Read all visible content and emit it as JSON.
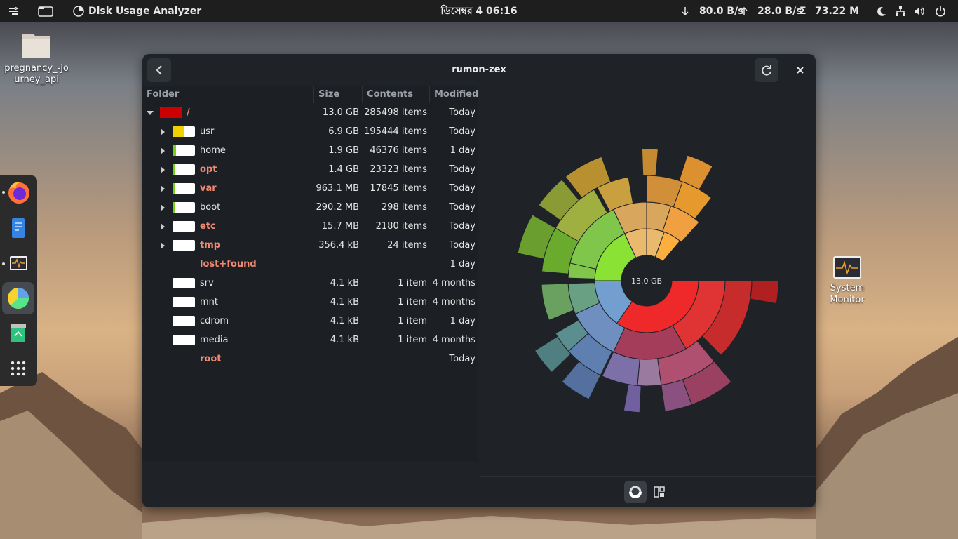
{
  "topbar": {
    "app_name": "Disk Usage Analyzer",
    "clock": "ডিসেম্বর 4  06:16",
    "net_down": "80.0 B/s",
    "net_up": "28.0 B/s",
    "mem_symbol": "Σ",
    "memory": "73.22 M"
  },
  "desktop": {
    "folder_label": "pregnancy_-journey_api",
    "sysmon_label": "System Monitor"
  },
  "window": {
    "title": "rumon-zex",
    "columns": {
      "folder": "Folder",
      "size": "Size",
      "contents": "Contents",
      "modified": "Modified"
    },
    "rows": [
      {
        "name": "/",
        "size": "13.0 GB",
        "contents": "285498 items",
        "modified": "Today",
        "emph": true,
        "fill": 1.0,
        "color": "#cc0000"
      },
      {
        "name": "usr",
        "size": "6.9 GB",
        "contents": "195444 items",
        "modified": "Today",
        "emph": false,
        "fill": 0.53,
        "color": "#f0d000"
      },
      {
        "name": "home",
        "size": "1.9 GB",
        "contents": "46376 items",
        "modified": "1 day",
        "emph": false,
        "fill": 0.15,
        "color": "#73d216"
      },
      {
        "name": "opt",
        "size": "1.4 GB",
        "contents": "23323 items",
        "modified": "Today",
        "emph": true,
        "fill": 0.11,
        "color": "#73d216"
      },
      {
        "name": "var",
        "size": "963.1 MB",
        "contents": "17845 items",
        "modified": "Today",
        "emph": true,
        "fill": 0.07,
        "color": "#73d216"
      },
      {
        "name": "boot",
        "size": "290.2 MB",
        "contents": "298 items",
        "modified": "Today",
        "emph": false,
        "fill": 0.02,
        "color": "#73d216"
      },
      {
        "name": "etc",
        "size": "15.7 MB",
        "contents": "2180 items",
        "modified": "Today",
        "emph": true,
        "fill": 0.0,
        "color": "#73d216"
      },
      {
        "name": "tmp",
        "size": "356.4 kB",
        "contents": "24 items",
        "modified": "Today",
        "emph": true,
        "fill": 0.0,
        "color": "#73d216"
      },
      {
        "name": "lost+found",
        "size": "",
        "contents": "",
        "modified": "1 day",
        "emph": true,
        "nobar": true
      },
      {
        "name": "srv",
        "size": "4.1 kB",
        "contents": "1 item",
        "modified": "4 months",
        "emph": false,
        "fill": 0.0
      },
      {
        "name": "mnt",
        "size": "4.1 kB",
        "contents": "1 item",
        "modified": "4 months",
        "emph": false,
        "fill": 0.0
      },
      {
        "name": "cdrom",
        "size": "4.1 kB",
        "contents": "1 item",
        "modified": "1 day",
        "emph": false,
        "fill": 0.0
      },
      {
        "name": "media",
        "size": "4.1 kB",
        "contents": "1 item",
        "modified": "4 months",
        "emph": false,
        "fill": 0.0
      },
      {
        "name": "root",
        "size": "",
        "contents": "",
        "modified": "Today",
        "emph": true,
        "nobar": true
      }
    ],
    "chart_center_label": "13.0 GB"
  },
  "colors": {
    "accent_red": "#cc0000",
    "chart_red": "#ef2929",
    "chart_green": "#8ae234",
    "chart_blue": "#729fcf",
    "chart_orange": "#fcaf3e",
    "chart_purple": "#ad7fa8"
  }
}
